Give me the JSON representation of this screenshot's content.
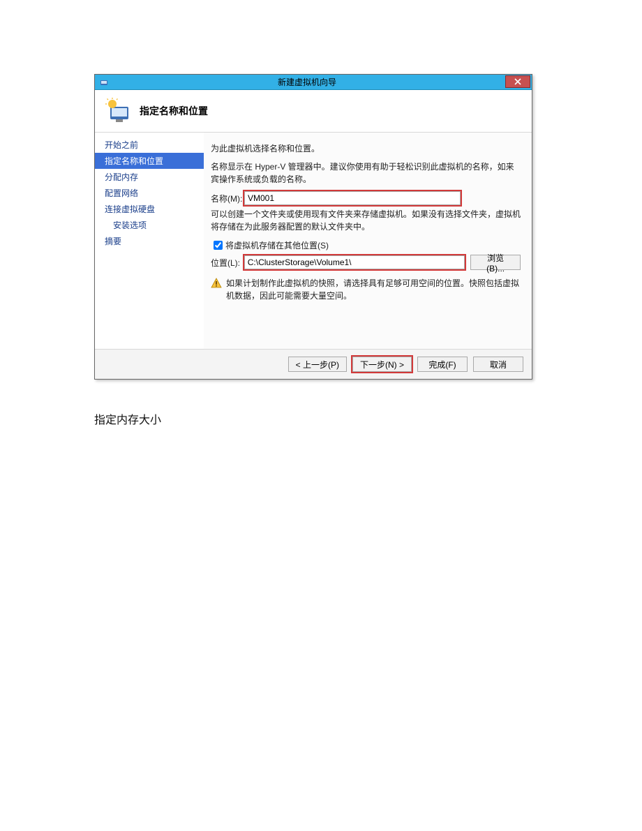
{
  "window": {
    "title": "新建虚拟机向导",
    "heading": "指定名称和位置"
  },
  "nav": {
    "items": [
      {
        "label": "开始之前",
        "selected": false,
        "indent": false
      },
      {
        "label": "指定名称和位置",
        "selected": true,
        "indent": false
      },
      {
        "label": "分配内存",
        "selected": false,
        "indent": false
      },
      {
        "label": "配置网络",
        "selected": false,
        "indent": false
      },
      {
        "label": "连接虚拟硬盘",
        "selected": false,
        "indent": false
      },
      {
        "label": "安装选项",
        "selected": false,
        "indent": true
      },
      {
        "label": "摘要",
        "selected": false,
        "indent": false
      }
    ]
  },
  "content": {
    "intro": "为此虚拟机选择名称和位置。",
    "desc": "名称显示在 Hyper-V 管理器中。建议你使用有助于轻松识别此虚拟机的名称，如来宾操作系统或负载的名称。",
    "name_label": "名称(M):",
    "name_value": "VM001",
    "folder_desc": "可以创建一个文件夹或使用现有文件夹来存储虚拟机。如果没有选择文件夹，虚拟机将存储在为此服务器配置的默认文件夹中。",
    "store_other_label": "将虚拟机存储在其他位置(S)",
    "store_other_checked": true,
    "location_label": "位置(L):",
    "location_value": "C:\\ClusterStorage\\Volume1\\",
    "browse_label": "浏览(B)...",
    "warning": "如果计划制作此虚拟机的快照，请选择具有足够可用空间的位置。快照包括虚拟机数据，因此可能需要大量空间。"
  },
  "footer": {
    "prev": "< 上一步(P)",
    "next": "下一步(N) >",
    "finish": "完成(F)",
    "cancel": "取消"
  },
  "page_caption": "指定内存大小"
}
